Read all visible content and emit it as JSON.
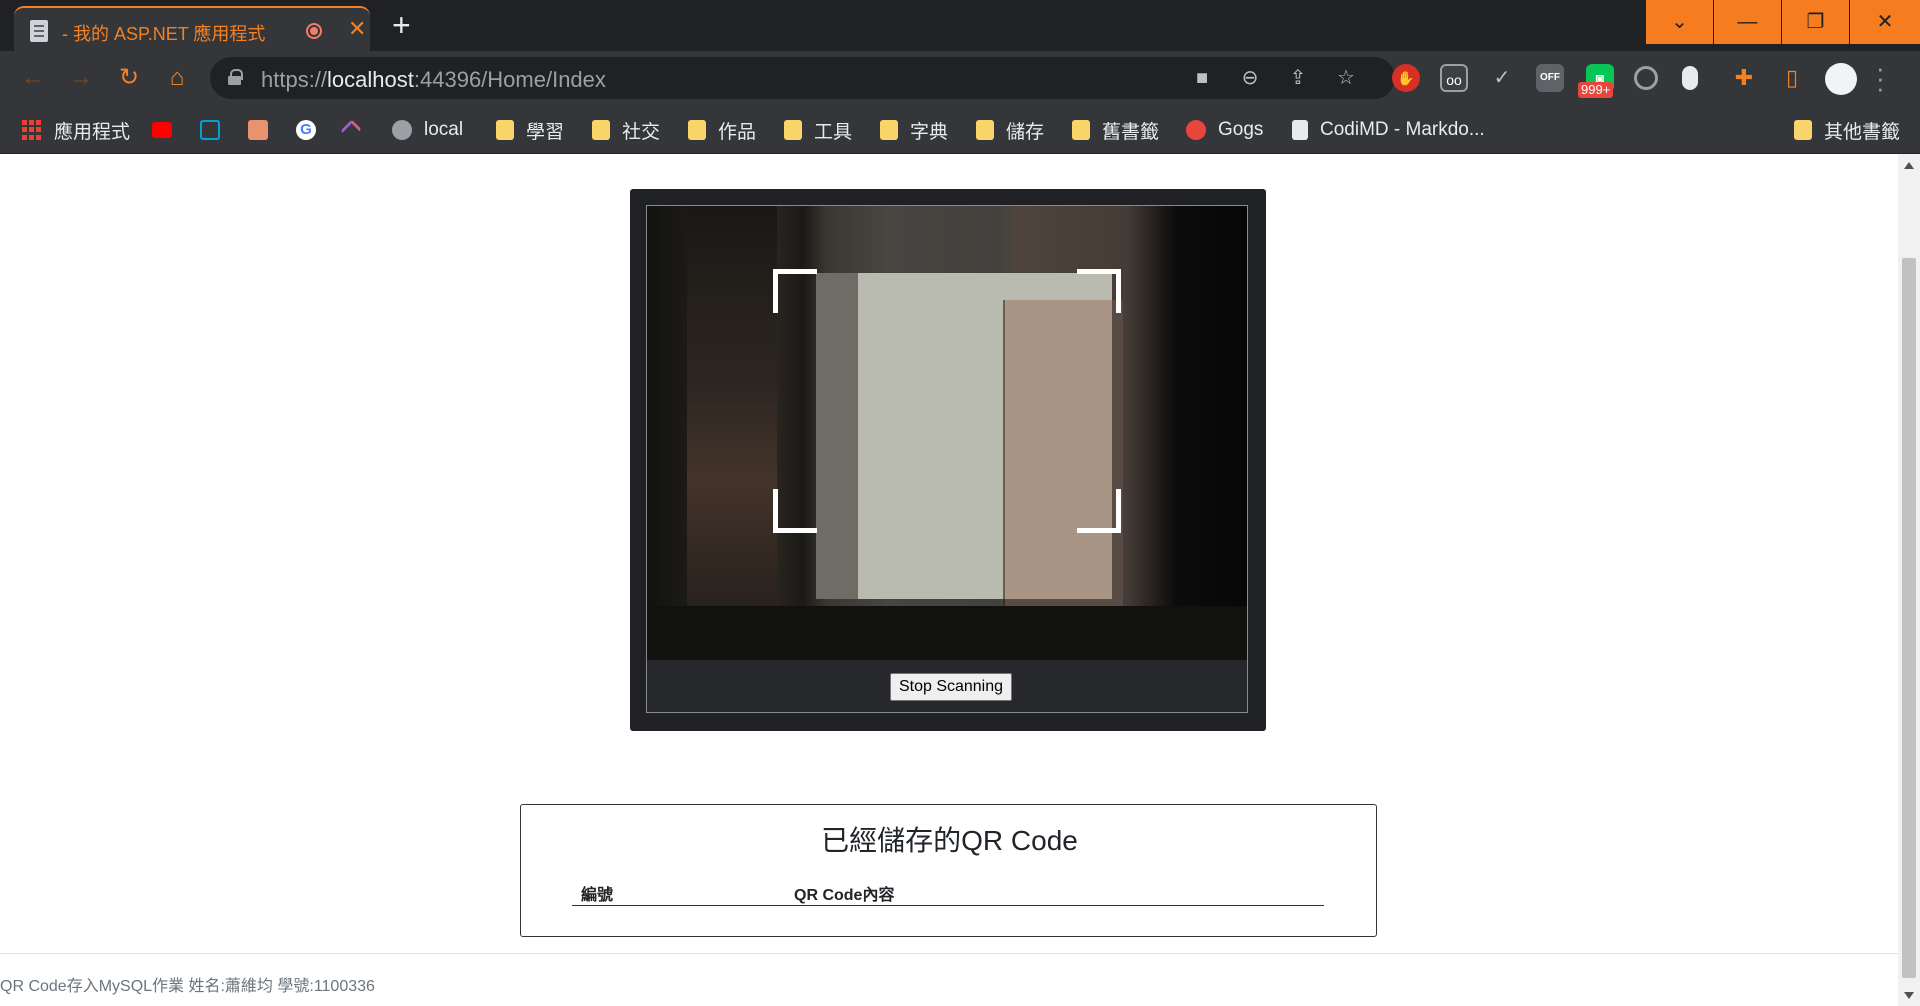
{
  "tab": {
    "title": "- 我的 ASP.NET 應用程式",
    "close": "✕"
  },
  "new_tab": "+",
  "window_controls": {
    "collapse": "⌄",
    "minimize": "—",
    "restore": "❐",
    "close": "✕"
  },
  "address": {
    "scheme": "https://",
    "host": "localhost",
    "rest": ":44396/Home/Index"
  },
  "extension_badge": "999+",
  "extension_off_label": "OFF",
  "bookmarks": [
    {
      "label": "應用程式",
      "icon": "apps-icon"
    },
    {
      "label": "",
      "icon": "youtube-icon"
    },
    {
      "label": "",
      "icon": "bilibili-icon"
    },
    {
      "label": "",
      "icon": "avatar-bookmark-icon"
    },
    {
      "label": "",
      "icon": "google-icon"
    },
    {
      "label": "",
      "icon": "purple-bookmark-icon"
    },
    {
      "label": "local",
      "icon": "globe-icon"
    },
    {
      "label": "學習",
      "icon": "folder-icon"
    },
    {
      "label": "社交",
      "icon": "folder-icon"
    },
    {
      "label": "作品",
      "icon": "folder-icon"
    },
    {
      "label": "工具",
      "icon": "folder-icon"
    },
    {
      "label": "字典",
      "icon": "folder-icon"
    },
    {
      "label": "儲存",
      "icon": "folder-icon"
    },
    {
      "label": "舊書籤",
      "icon": "folder-icon"
    },
    {
      "label": "Gogs",
      "icon": "gogs-icon"
    },
    {
      "label": "CodiMD - Markdo...",
      "icon": "codimd-icon"
    }
  ],
  "other_bookmarks": "其他書籤",
  "scanner": {
    "stop_button": "Stop Scanning"
  },
  "saved": {
    "title": "已經儲存的QR  Code",
    "columns": [
      "編號",
      "QR  Code內容"
    ]
  },
  "footer": "QR Code存入MySQL作業 姓名:蕭維均  學號:1100336",
  "colors": {
    "accent": "#f48024",
    "chrome_dark": "#202124",
    "chrome": "#35363a"
  }
}
